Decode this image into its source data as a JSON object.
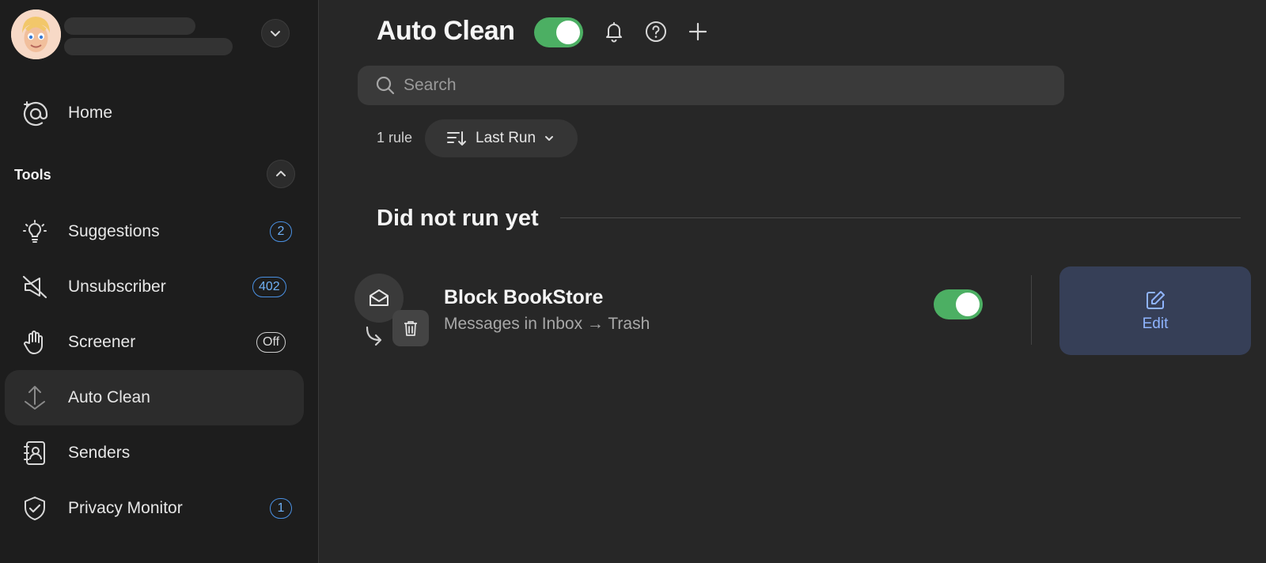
{
  "sidebar": {
    "home_label": "Home",
    "section_title": "Tools",
    "items": [
      {
        "label": "Suggestions",
        "badge": "2"
      },
      {
        "label": "Unsubscriber",
        "badge": "402"
      },
      {
        "label": "Screener",
        "badge": "Off"
      },
      {
        "label": "Auto Clean",
        "badge": ""
      },
      {
        "label": "Senders",
        "badge": ""
      },
      {
        "label": "Privacy Monitor",
        "badge": "1"
      }
    ],
    "active_item": "Auto Clean"
  },
  "header": {
    "title": "Auto Clean",
    "enabled": true,
    "icons": [
      "bell-icon",
      "help-icon",
      "plus-icon"
    ]
  },
  "search": {
    "placeholder": "Search",
    "value": ""
  },
  "toolbar": {
    "rule_count": "1 rule",
    "sort_label": "Last Run"
  },
  "group": {
    "title": "Did not run yet",
    "rules": [
      {
        "name": "Block BookStore",
        "description": "Messages in Inbox → Trash",
        "enabled": true,
        "edit_label": "Edit"
      }
    ]
  },
  "colors": {
    "accent_green": "#4caf63",
    "badge_blue": "#4a90e2",
    "edit_bg": "#363f57",
    "edit_text": "#8fb4ff"
  }
}
